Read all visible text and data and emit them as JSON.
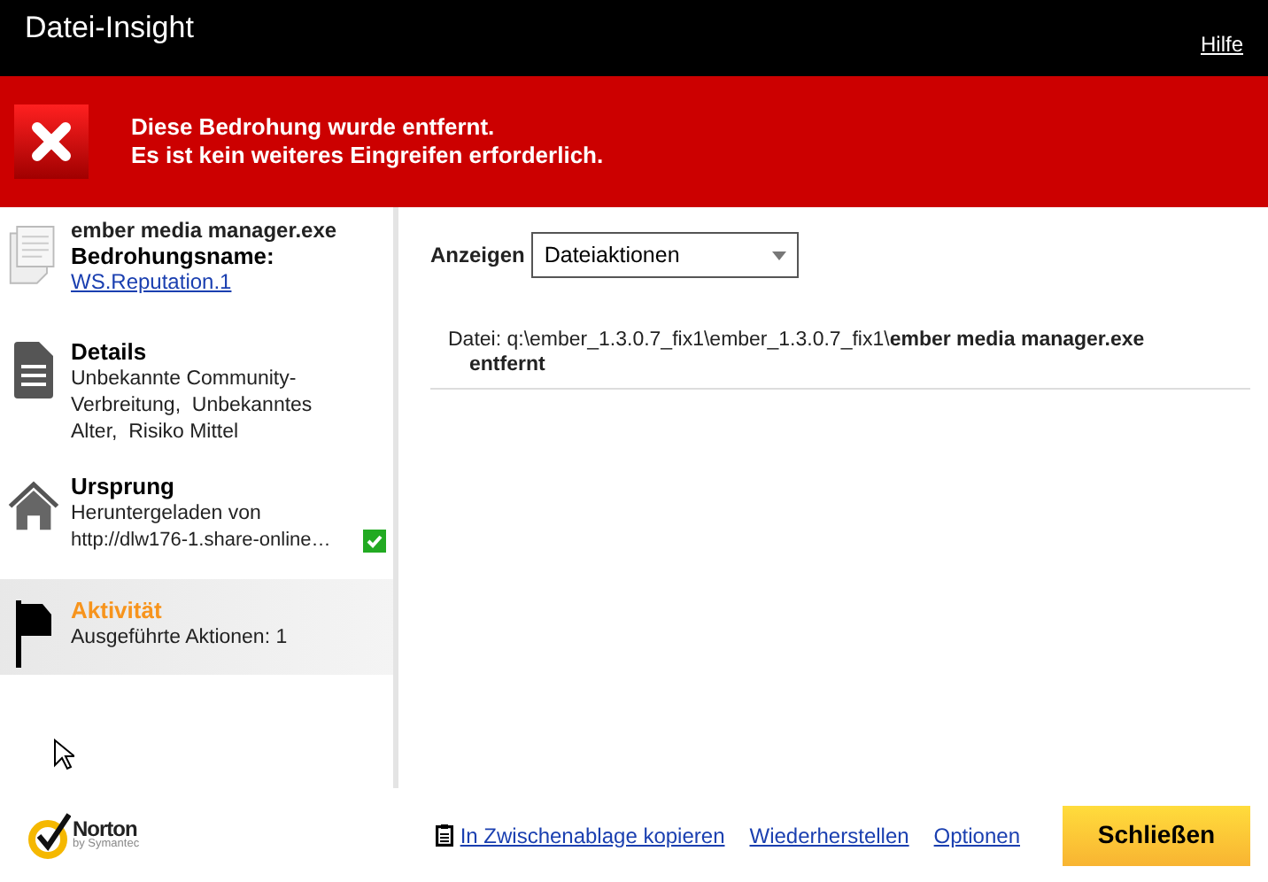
{
  "window": {
    "title": "Datei-Insight",
    "help_link": "Hilfe"
  },
  "banner": {
    "lines": [
      "Diese Bedrohung wurde entfernt.",
      "Es ist kein weiteres Eingreifen erforderlich."
    ]
  },
  "sidebar": {
    "items": [
      {
        "kind": "threat",
        "file": "ember media manager.exe",
        "label": "Bedrohungsname:",
        "link": "WS.Reputation.1",
        "selected": false
      },
      {
        "kind": "section",
        "title": "Details",
        "text": "Unbekannte Community-Verbreitung,  Unbekanntes Alter,  Risiko Mittel",
        "selected": false
      },
      {
        "kind": "section",
        "title": "Ursprung",
        "text": "Heruntergeladen von",
        "extra": "http://dlw176-1.share-online…",
        "verified": true,
        "selected": false
      },
      {
        "kind": "section",
        "title": "Aktivität",
        "text": "Ausgeführte Aktionen: 1",
        "selected": true
      }
    ]
  },
  "main": {
    "filter_label": "Anzeigen",
    "filter_value": "Dateiaktionen",
    "entries": [
      {
        "path": "Datei: q:\\ember_1.3.0.7_fix1\\ember_1.3.0.7_fix1\\",
        "file": "ember media manager.exe",
        "action": "entfernt"
      }
    ]
  },
  "footer": {
    "logo": {
      "name": "Norton",
      "sub": "by Symantec"
    },
    "links": [
      "In Zwischenablage kopieren",
      "Wiederherstellen",
      "Optionen"
    ],
    "close_button": "Schließen"
  }
}
